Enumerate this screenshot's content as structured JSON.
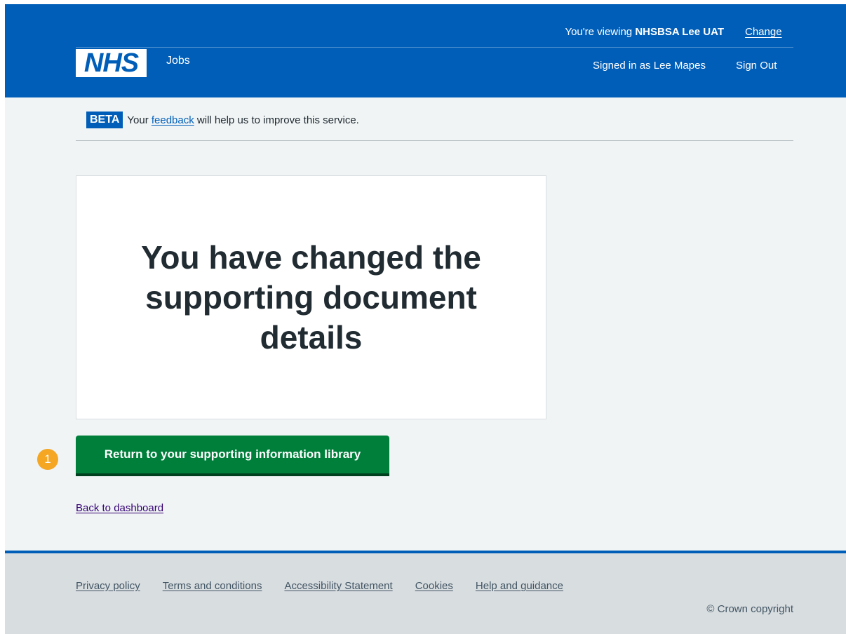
{
  "header": {
    "viewing_prefix": "You're viewing ",
    "viewing_org": "NHSBSA Lee UAT",
    "change_label": "Change",
    "logo_text": "NHS",
    "service_name": "Jobs",
    "signed_in_text": "Signed in as Lee Mapes",
    "sign_out_label": "Sign Out"
  },
  "beta": {
    "tag": "BETA",
    "text_before": "Your ",
    "link_text": "feedback",
    "text_after": " will help us to improve this service."
  },
  "main": {
    "heading": "You have changed the supporting document details",
    "step_marker": "1",
    "primary_button_label": "Return to your supporting information library",
    "back_link_label": "Back to dashboard"
  },
  "footer": {
    "links": [
      "Privacy policy",
      "Terms and conditions",
      "Accessibility Statement",
      "Cookies",
      "Help and guidance"
    ],
    "copyright": "© Crown copyright"
  },
  "colors": {
    "header_blue": "#005eb8",
    "button_green": "#007f3b",
    "marker_orange": "#f5a623",
    "page_background": "#f0f4f5",
    "footer_background": "#d8dde0"
  }
}
